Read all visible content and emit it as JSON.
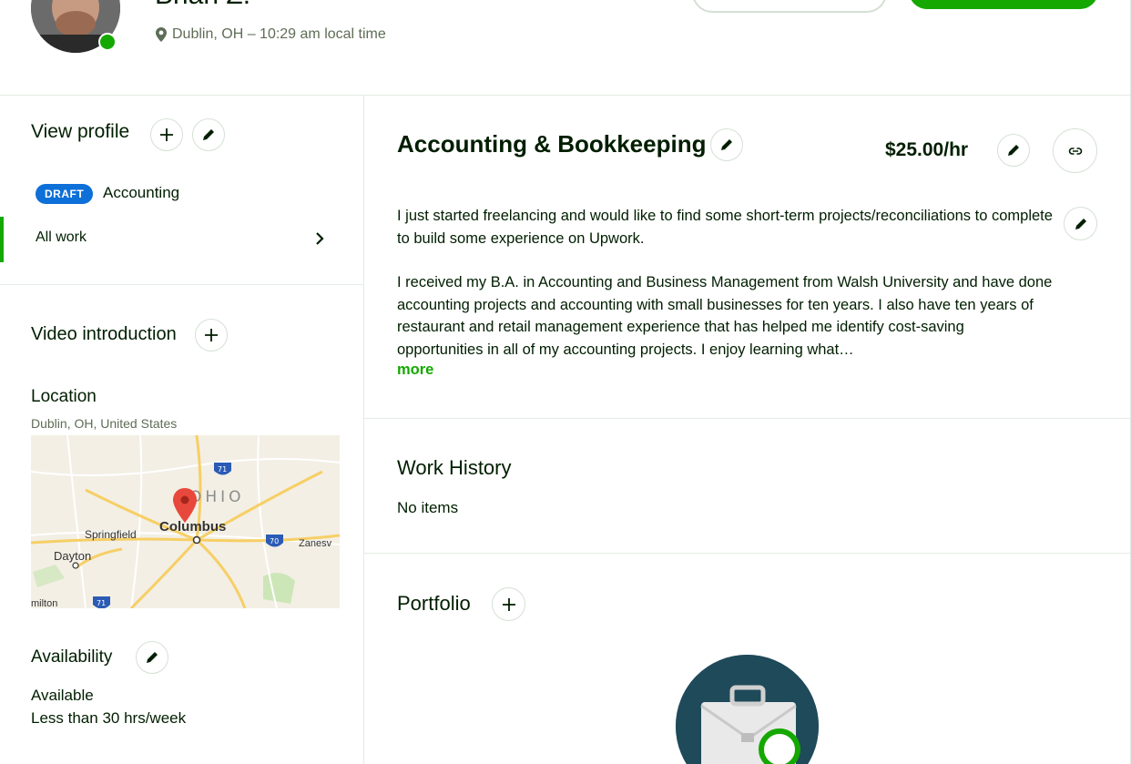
{
  "header": {
    "user_name": "Brian Z.",
    "location_text": "Dublin, OH – 10:29 am local time"
  },
  "sidebar": {
    "view_profile_label": "View profile",
    "draft_badge": "DRAFT",
    "draft_profile_name": "Accounting",
    "all_work_label": "All work",
    "video_intro_label": "Video introduction",
    "location_title": "Location",
    "location_value": "Dublin, OH, United States",
    "map": {
      "labels": {
        "ohio": "OHIO",
        "columbus": "Columbus",
        "springfield": "Springfield",
        "dayton": "Dayton",
        "zanesville": "Zanesv",
        "hamilton": "milton",
        "i71_top": "71",
        "i70": "70",
        "i71_bottom": "71"
      }
    },
    "availability_title": "Availability",
    "availability_value": "Available",
    "availability_hours": "Less than 30 hrs/week"
  },
  "main": {
    "title": "Accounting & Bookkeeping",
    "rate": "$25.00/hr",
    "description_p1": "I just started freelancing and would like to find some short-term projects/reconciliations to complete to build some experience on Upwork.",
    "description_p2": "I received my B.A. in Accounting and Business Management from Walsh University and have done accounting projects and accounting with small businesses for ten years. I also have ten years of restaurant and retail management experience that has helped me identify cost-saving opportunities in all of my accounting projects. I enjoy learning what…",
    "more_label": "more",
    "work_history_title": "Work History",
    "work_history_empty": "No items",
    "portfolio_title": "Portfolio"
  },
  "colors": {
    "accent_green": "#14a800",
    "badge_blue": "#0d6fd8",
    "text_dark": "#001e00",
    "text_muted": "#5e6d55",
    "divider": "#e4ebe4"
  },
  "icons": {
    "plus": "plus-icon",
    "edit": "pencil-icon",
    "link": "link-icon",
    "pin": "map-pin-icon",
    "chevron": "chevron-right-icon"
  }
}
